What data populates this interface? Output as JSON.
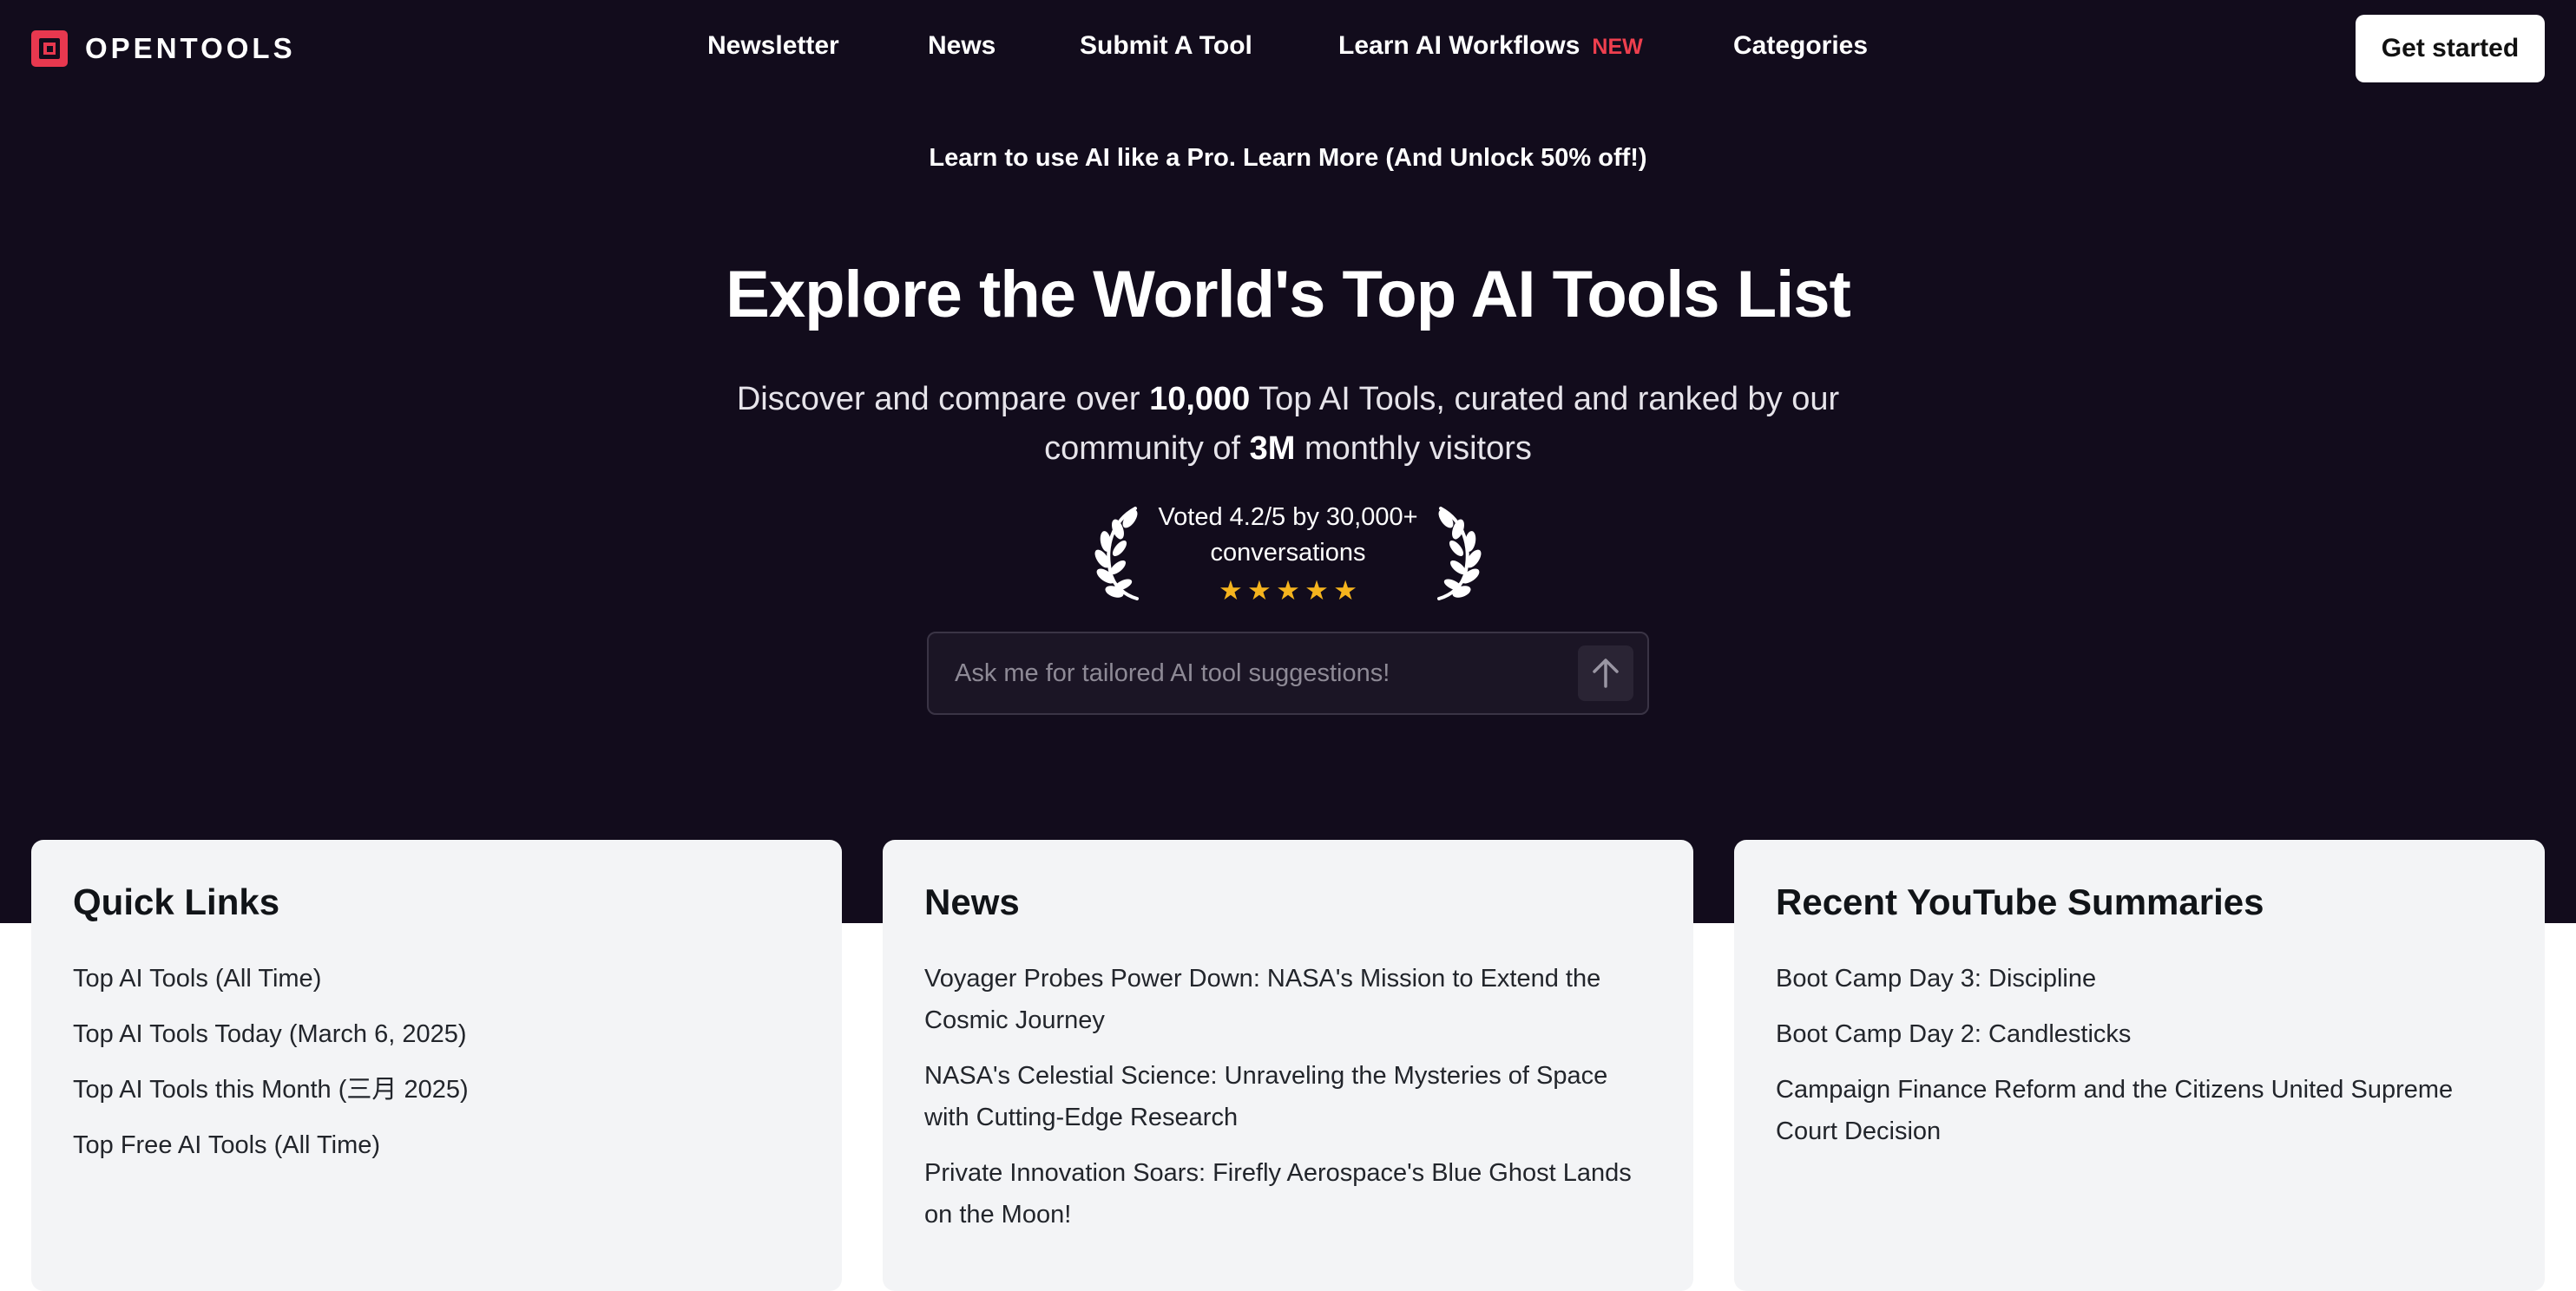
{
  "header": {
    "logo_text": "OPENTOOLS",
    "nav": [
      {
        "label": "Newsletter"
      },
      {
        "label": "News"
      },
      {
        "label": "Submit A Tool"
      },
      {
        "label": "Learn AI Workflows",
        "badge": "NEW"
      },
      {
        "label": "Categories"
      }
    ],
    "cta_label": "Get started"
  },
  "promo_banner": "Learn to use AI like a Pro. Learn More (And Unlock 50% off!)",
  "hero": {
    "title": "Explore the World's Top AI Tools List",
    "subtitle_part1": "Discover and compare over ",
    "subtitle_bold1": "10,000",
    "subtitle_part2": " Top AI Tools, curated and ranked by our community of ",
    "subtitle_bold2": "3M",
    "subtitle_part3": " monthly visitors",
    "rating_line1": "Voted 4.2/5 by 30,000+",
    "rating_line2": "conversations",
    "stars": 5
  },
  "search": {
    "placeholder": "Ask me for tailored AI tool suggestions!"
  },
  "cards": {
    "quick_links": {
      "title": "Quick Links",
      "items": [
        "Top AI Tools (All Time)",
        "Top AI Tools Today (March 6, 2025)",
        "Top AI Tools this Month (三月 2025)",
        "Top Free AI Tools (All Time)"
      ]
    },
    "news": {
      "title": "News",
      "items": [
        "Voyager Probes Power Down: NASA's Mission to Extend the Cosmic Journey",
        "NASA's Celestial Science: Unraveling the Mysteries of Space with Cutting-Edge Research",
        "Private Innovation Soars: Firefly Aerospace's Blue Ghost Lands on the Moon!"
      ]
    },
    "youtube": {
      "title": "Recent YouTube Summaries",
      "items": [
        "Boot Camp Day 3: Discipline",
        "Boot Camp Day 2: Candlesticks",
        "Campaign Finance Reform and the Citizens United Supreme Court Decision"
      ]
    }
  },
  "colors": {
    "hero_bg": "#120c1c",
    "brand_red": "#e8384f",
    "new_badge": "#ef3f4e",
    "star": "#f5b41e",
    "card_bg": "#f3f4f6"
  }
}
